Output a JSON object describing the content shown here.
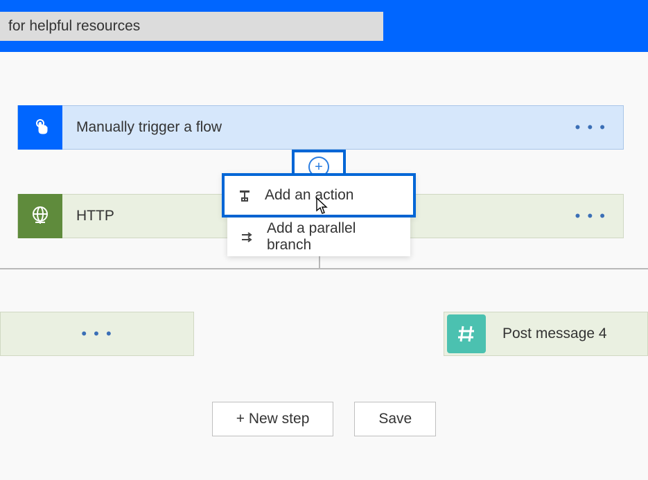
{
  "header": {
    "search_value": "for helpful resources"
  },
  "steps": {
    "trigger": {
      "label": "Manually trigger a flow"
    },
    "http": {
      "label": "HTTP"
    },
    "post_message": {
      "label": "Post message 4"
    }
  },
  "popup": {
    "add_action": "Add an action",
    "add_parallel": "Add a parallel branch"
  },
  "buttons": {
    "new_step": "+ New step",
    "save": "Save"
  },
  "icons": {
    "menu_dots": "• • •"
  }
}
